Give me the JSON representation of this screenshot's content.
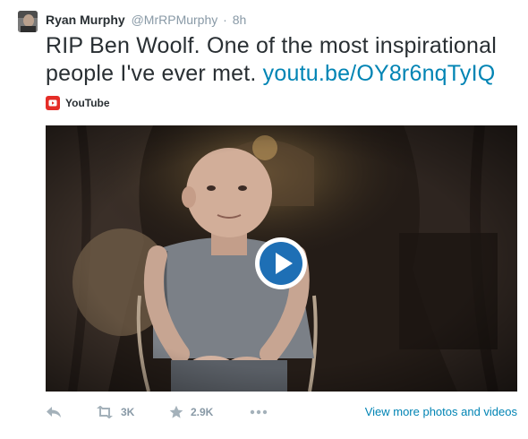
{
  "tweet": {
    "author_name": "Ryan Murphy",
    "author_handle": "@MrRPMurphy",
    "separator": "·",
    "time": "8h",
    "text": "RIP Ben Woolf. One of the most inspirational people I've ever met.",
    "link_text": "youtu.be/OY8r6nqTyIQ",
    "source_label": "YouTube"
  },
  "actions": {
    "retweet_count": "3K",
    "favorite_count": "2.9K",
    "more_label": "View more photos and videos"
  },
  "icons": {
    "source": "youtube-icon",
    "play": "play-icon",
    "reply": "reply-icon",
    "retweet": "retweet-icon",
    "favorite": "star-icon",
    "more": "more-dots-icon"
  },
  "colors": {
    "link": "#0084b4",
    "muted": "#8899a6",
    "text": "#292f33",
    "youtube": "#e52d27",
    "play_button": "#1e6fb5"
  }
}
